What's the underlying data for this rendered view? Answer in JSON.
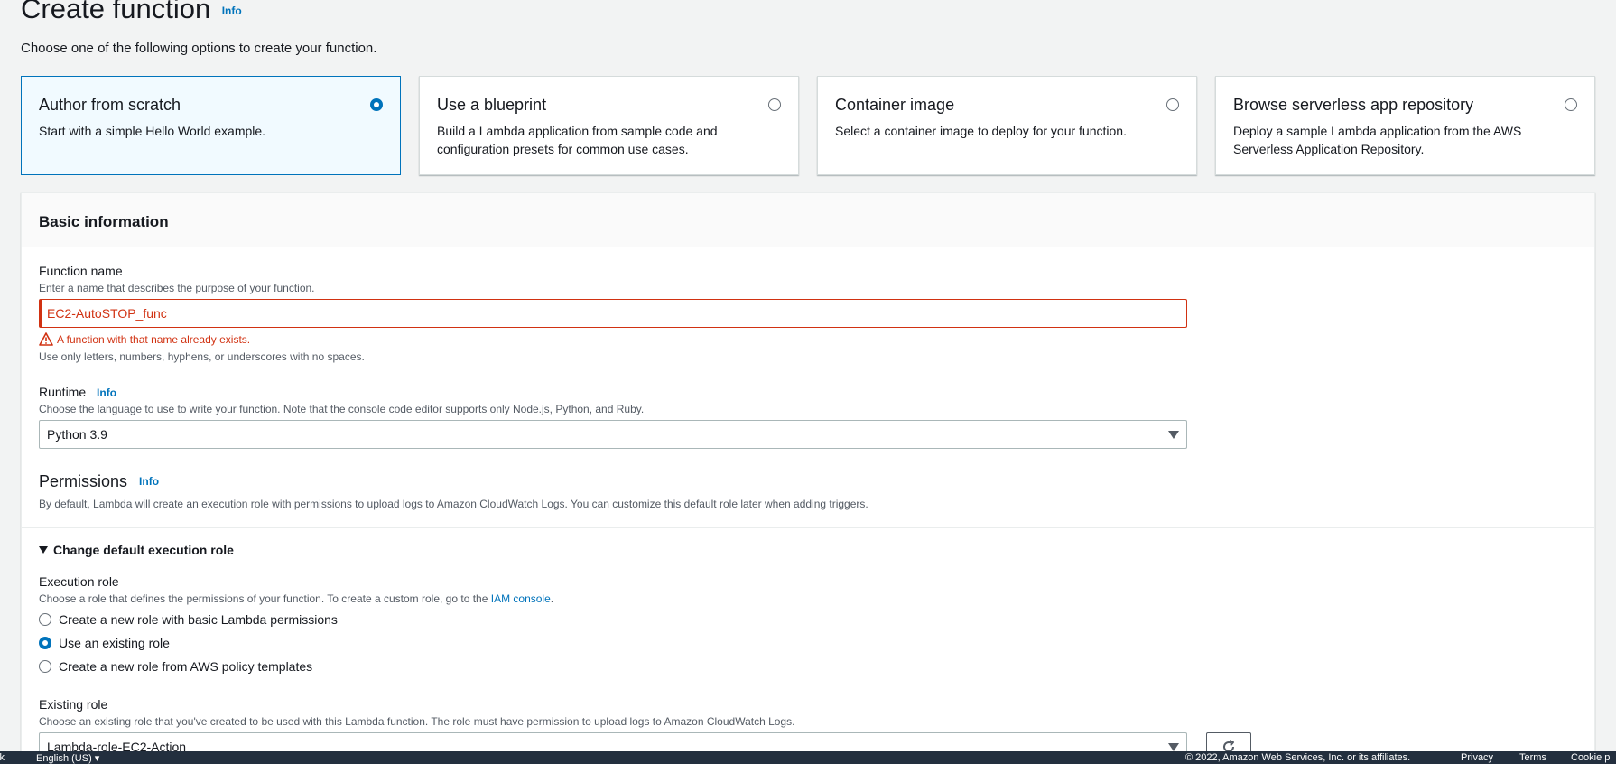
{
  "header": {
    "title": "Create function",
    "info": "Info",
    "subtitle": "Choose one of the following options to create your function."
  },
  "options": [
    {
      "title": "Author from scratch",
      "desc": "Start with a simple Hello World example.",
      "selected": true
    },
    {
      "title": "Use a blueprint",
      "desc": "Build a Lambda application from sample code and configuration presets for common use cases.",
      "selected": false
    },
    {
      "title": "Container image",
      "desc": "Select a container image to deploy for your function.",
      "selected": false
    },
    {
      "title": "Browse serverless app repository",
      "desc": "Deploy a sample Lambda application from the AWS Serverless Application Repository.",
      "selected": false
    }
  ],
  "basic_info": {
    "title": "Basic information",
    "function_name": {
      "label": "Function name",
      "desc": "Enter a name that describes the purpose of your function.",
      "value": "EC2-AutoSTOP_func",
      "error": "A function with that name already exists.",
      "constraint": "Use only letters, numbers, hyphens, or underscores with no spaces."
    },
    "runtime": {
      "label": "Runtime",
      "info": "Info",
      "desc": "Choose the language to use to write your function. Note that the console code editor supports only Node.js, Python, and Ruby.",
      "value": "Python 3.9"
    },
    "permissions": {
      "title": "Permissions",
      "info": "Info",
      "desc": "By default, Lambda will create an execution role with permissions to upload logs to Amazon CloudWatch Logs. You can customize this default role later when adding triggers."
    },
    "change_role": {
      "label": "Change default execution role"
    },
    "execution_role": {
      "label": "Execution role",
      "desc_prefix": "Choose a role that defines the permissions of your function. To create a custom role, go to the",
      "desc_link": "IAM console",
      "desc_suffix": ".",
      "options": [
        {
          "label": "Create a new role with basic Lambda permissions",
          "selected": false
        },
        {
          "label": "Use an existing role",
          "selected": true
        },
        {
          "label": "Create a new role from AWS policy templates",
          "selected": false
        }
      ]
    },
    "existing_role": {
      "label": "Existing role",
      "desc": "Choose an existing role that you've created to be used with this Lambda function. The role must have permission to upload logs to Amazon CloudWatch Logs.",
      "value": "Lambda-role-EC2-Action"
    }
  },
  "footer": {
    "language": "English (US) ▾",
    "copyright": "© 2022, Amazon Web Services, Inc. or its affiliates.",
    "privacy": "Privacy",
    "terms": "Terms",
    "cookie": "Cookie p"
  },
  "colors": {
    "accent": "#0073bb",
    "error": "#d13212",
    "footer_bg": "#232f3e"
  }
}
